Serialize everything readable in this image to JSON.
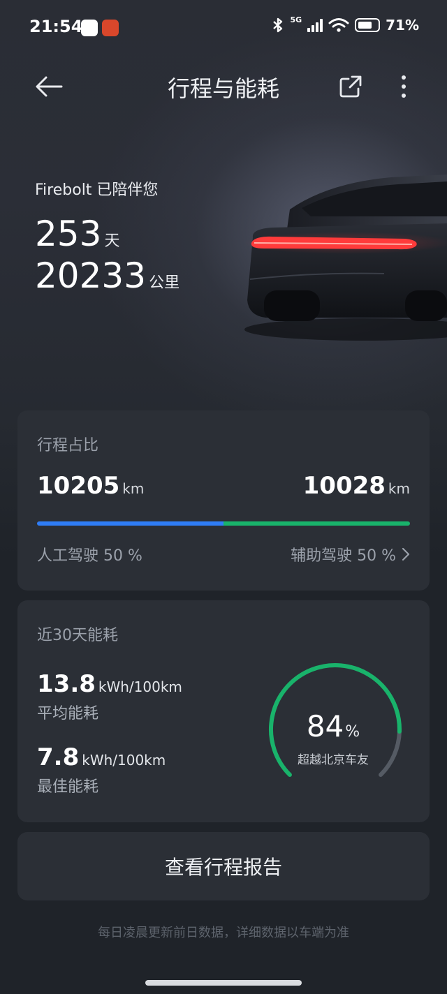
{
  "status_bar": {
    "time": "21:54",
    "network": "5G",
    "battery_percent": "71%",
    "battery_level": 0.71,
    "icons": [
      "bluetooth-icon",
      "signal-icon",
      "wifi-icon",
      "battery-icon"
    ]
  },
  "header": {
    "title": "行程与能耗",
    "icons": [
      "back-arrow-icon",
      "share-icon",
      "more-icon"
    ]
  },
  "hero": {
    "companion_text": "Firebolt 已陪伴您",
    "days_value": "253",
    "days_unit": "天",
    "distance_value": "20233",
    "distance_unit": "公里"
  },
  "trip_share": {
    "title": "行程占比",
    "manual_km": "10205",
    "assisted_km": "10028",
    "km_unit": "km",
    "manual_label": "人工驾驶 50 %",
    "assisted_label": "辅助驾驶 50 %",
    "manual_fraction": 0.5,
    "colors": {
      "manual": "#2f7df6",
      "assisted": "#19b36b"
    }
  },
  "energy": {
    "title": "近30天能耗",
    "avg_value": "13.8",
    "avg_unit": "kWh/100km",
    "avg_label": "平均能耗",
    "best_value": "7.8",
    "best_unit": "kWh/100km",
    "best_label": "最佳能耗",
    "percentile_value": "84",
    "percentile_unit": "%",
    "percentile_fraction": 0.84,
    "percentile_label": "超越北京车友",
    "colors": {
      "gauge_fill": "#19b36b",
      "gauge_track": "#555b64"
    }
  },
  "report_button": {
    "label": "查看行程报告"
  },
  "footnote": "每日凌晨更新前日数据，详细数据以车端为准"
}
